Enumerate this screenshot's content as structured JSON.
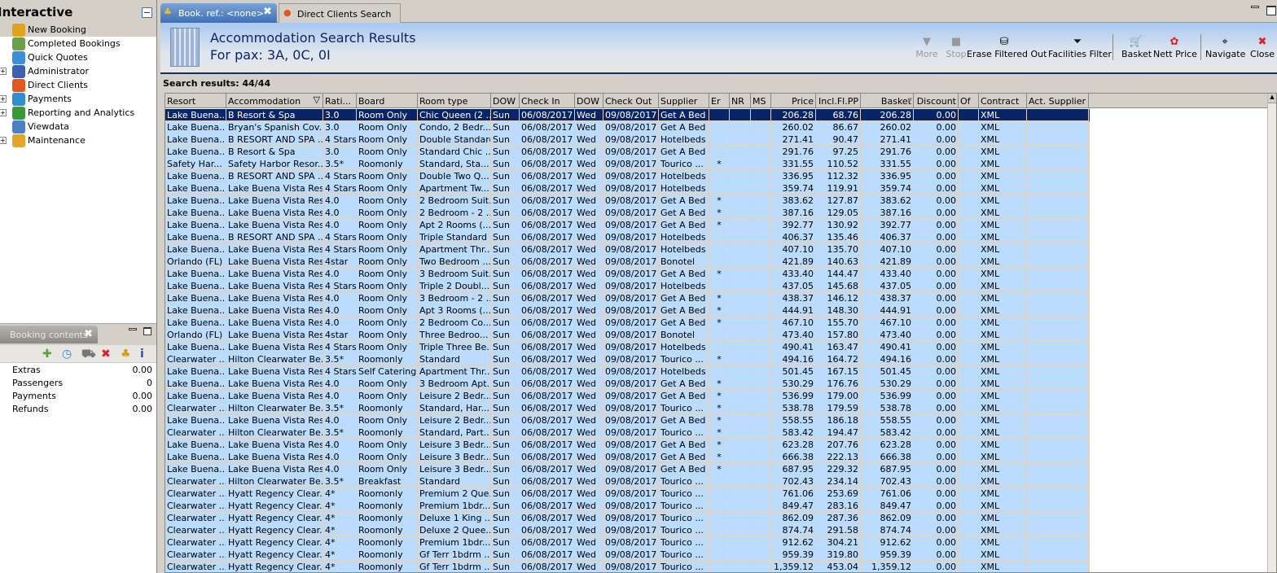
{
  "left": {
    "title": "Interactive",
    "items": [
      {
        "label": "New Booking",
        "icon": "palm-tree-icon",
        "color": "#e3a21a",
        "expandable": false,
        "selected": true
      },
      {
        "label": "Completed Bookings",
        "icon": "palm-money-icon",
        "color": "#6aa04a",
        "expandable": false
      },
      {
        "label": "Quick Quotes",
        "icon": "clock-icon",
        "color": "#3d8fd9",
        "expandable": false
      },
      {
        "label": "Administrator",
        "icon": "runner-icon",
        "color": "#3a62b0",
        "expandable": true
      },
      {
        "label": "Direct Clients",
        "icon": "client-icon",
        "color": "#e2581f",
        "expandable": false
      },
      {
        "label": "Payments",
        "icon": "payment-card-icon",
        "color": "#2f8fd0",
        "expandable": true
      },
      {
        "label": "Reporting and Analytics",
        "icon": "report-icon",
        "color": "#3a9a3a",
        "expandable": true
      },
      {
        "label": "Viewdata",
        "icon": "globe-icon",
        "color": "#4b7fc9",
        "expandable": false
      },
      {
        "label": "Maintenance",
        "icon": "maintenance-icon",
        "color": "#e2a52a",
        "expandable": true
      }
    ]
  },
  "booking_contents": {
    "tab": "Booking contents",
    "tools": [
      {
        "icon": "add-icon",
        "glyph": "✚",
        "color": "#5aa33a"
      },
      {
        "icon": "clock-icon",
        "glyph": "◷",
        "color": "#2b86d6"
      },
      {
        "icon": "cart-icon",
        "glyph": "⛟",
        "color": "#777"
      },
      {
        "icon": "delete-icon",
        "glyph": "✖",
        "color": "#e02020"
      },
      {
        "icon": "palm-tree-icon",
        "glyph": "♣",
        "color": "#d79b12"
      },
      {
        "icon": "info-icon",
        "glyph": "i",
        "color": "#1e55b0"
      }
    ],
    "rows": [
      {
        "label": "Extras",
        "value": "0.00"
      },
      {
        "label": "Passengers",
        "value": "0"
      },
      {
        "label": "Payments",
        "value": "0.00"
      },
      {
        "label": "Refunds",
        "value": "0.00"
      }
    ]
  },
  "tabs": [
    {
      "label": "Book. ref.: <none>"
    },
    {
      "label": "Direct Clients Search"
    }
  ],
  "header": {
    "title": "Accommodation Search Results",
    "pax": "For pax: 3A, 0C, 0I"
  },
  "toolbar": [
    {
      "label": "More",
      "glyph": "▼",
      "disabled": true
    },
    {
      "label": "Stop",
      "glyph": "■",
      "disabled": true
    },
    {
      "label": "Erase Filtered Out",
      "glyph": "⛁",
      "disabled": false
    },
    {
      "label": "Facilities Filter",
      "glyph": "⏷",
      "disabled": false
    },
    {
      "label": "Basket",
      "glyph": "🛒",
      "disabled": false
    },
    {
      "label": "Nett Price",
      "glyph": "✿",
      "disabled": false
    },
    {
      "label": "Navigate",
      "glyph": "⌖",
      "disabled": false
    },
    {
      "label": "Close",
      "glyph": "✖",
      "disabled": false
    }
  ],
  "search_results": "Search results: 44/44",
  "table": {
    "columns": [
      "Resort",
      "Accommodation",
      "Rati...",
      "Board",
      "Room type",
      "DOW",
      "Check In",
      "DOW",
      "Check Out",
      "Supplier",
      "Er",
      "NR",
      "MS",
      "Price",
      "Incl.Fl.PP",
      "Basket",
      "Discount",
      "Of",
      "Contract",
      "Act. Supplier"
    ],
    "filter_column": "Accommodation",
    "sort_column": "Basket",
    "rows": [
      [
        "Lake Buena...",
        "B Resort & Spa",
        "3.0",
        "Room Only",
        "Chic Queen (2 ...",
        "Sun",
        "06/08/2017",
        "Wed",
        "09/08/2017",
        "Get A Bed",
        "",
        "",
        "",
        "206.28",
        "68.76",
        "206.28",
        "0.00",
        "",
        "XML",
        ""
      ],
      [
        "Lake Buena...",
        "Bryan's Spanish Cov...",
        "3.0",
        "Room Only",
        "Condo, 2 Bedr...",
        "Sun",
        "06/08/2017",
        "Wed",
        "09/08/2017",
        "Get A Bed",
        "",
        "",
        "",
        "260.02",
        "86.67",
        "260.02",
        "0.00",
        "",
        "XML",
        ""
      ],
      [
        "Lake Buena...",
        "B RESORT AND SPA ...",
        "4 Stars",
        "Room Only",
        "Double Standard",
        "Sun",
        "06/08/2017",
        "Wed",
        "09/08/2017",
        "Hotelbeds",
        "",
        "",
        "",
        "271.41",
        "90.47",
        "271.41",
        "0.00",
        "",
        "XML",
        ""
      ],
      [
        "Lake Buena...",
        "B Resort & Spa",
        "3.0",
        "Room Only",
        "Standard Chic ...",
        "Sun",
        "06/08/2017",
        "Wed",
        "09/08/2017",
        "Get A Bed",
        "",
        "",
        "",
        "291.76",
        "97.25",
        "291.76",
        "0.00",
        "",
        "XML",
        ""
      ],
      [
        "Safety Har...",
        "Safety Harbor Resor...",
        "3.5*",
        "Roomonly",
        "Standard, Sta...",
        "Sun",
        "06/08/2017",
        "Wed",
        "09/08/2017",
        "Tourico ...",
        "*",
        "",
        "",
        "331.55",
        "110.52",
        "331.55",
        "0.00",
        "",
        "XML",
        ""
      ],
      [
        "Lake Buena...",
        "B RESORT AND SPA ...",
        "4 Stars",
        "Room Only",
        "Double Two Q...",
        "Sun",
        "06/08/2017",
        "Wed",
        "09/08/2017",
        "Hotelbeds",
        "",
        "",
        "",
        "336.95",
        "112.32",
        "336.95",
        "0.00",
        "",
        "XML",
        ""
      ],
      [
        "Lake Buena...",
        "Lake Buena Vista Res...",
        "4 Stars",
        "Room Only",
        "Apartment Tw...",
        "Sun",
        "06/08/2017",
        "Wed",
        "09/08/2017",
        "Hotelbeds",
        "",
        "",
        "",
        "359.74",
        "119.91",
        "359.74",
        "0.00",
        "",
        "XML",
        ""
      ],
      [
        "Lake Buena...",
        "Lake Buena Vista Res...",
        "4.0",
        "Room Only",
        "2 Bedroom Suit...",
        "Sun",
        "06/08/2017",
        "Wed",
        "09/08/2017",
        "Get A Bed",
        "*",
        "",
        "",
        "383.62",
        "127.87",
        "383.62",
        "0.00",
        "",
        "XML",
        ""
      ],
      [
        "Lake Buena...",
        "Lake Buena Vista Res...",
        "4.0",
        "Room Only",
        "2 Bedroom - 2 ...",
        "Sun",
        "06/08/2017",
        "Wed",
        "09/08/2017",
        "Get A Bed",
        "*",
        "",
        "",
        "387.16",
        "129.05",
        "387.16",
        "0.00",
        "",
        "XML",
        ""
      ],
      [
        "Lake Buena...",
        "Lake Buena Vista Res...",
        "4.0",
        "Room Only",
        "Apt 2 Rooms (...",
        "Sun",
        "06/08/2017",
        "Wed",
        "09/08/2017",
        "Get A Bed",
        "*",
        "",
        "",
        "392.77",
        "130.92",
        "392.77",
        "0.00",
        "",
        "XML",
        ""
      ],
      [
        "Lake Buena...",
        "B RESORT AND SPA ...",
        "4 Stars",
        "Room Only",
        "Triple Standard",
        "Sun",
        "06/08/2017",
        "Wed",
        "09/08/2017",
        "Hotelbeds",
        "",
        "",
        "",
        "406.37",
        "135.46",
        "406.37",
        "0.00",
        "",
        "XML",
        ""
      ],
      [
        "Lake Buena...",
        "Lake Buena Vista Res...",
        "4 Stars",
        "Room Only",
        "Apartment Thr...",
        "Sun",
        "06/08/2017",
        "Wed",
        "09/08/2017",
        "Hotelbeds",
        "",
        "",
        "",
        "407.10",
        "135.70",
        "407.10",
        "0.00",
        "",
        "XML",
        ""
      ],
      [
        "Orlando (FL)",
        "Lake Buena Vista Res...",
        "4star",
        "Room Only",
        "Two Bedroom ...",
        "Sun",
        "06/08/2017",
        "Wed",
        "09/08/2017",
        "Bonotel",
        "",
        "",
        "",
        "421.89",
        "140.63",
        "421.89",
        "0.00",
        "",
        "XML",
        ""
      ],
      [
        "Lake Buena...",
        "Lake Buena Vista Res...",
        "4.0",
        "Room Only",
        "3 Bedroom Suit...",
        "Sun",
        "06/08/2017",
        "Wed",
        "09/08/2017",
        "Get A Bed",
        "*",
        "",
        "",
        "433.40",
        "144.47",
        "433.40",
        "0.00",
        "",
        "XML",
        ""
      ],
      [
        "Lake Buena...",
        "Lake Buena Vista Res...",
        "4 Stars",
        "Room Only",
        "Triple 2  Doubl...",
        "Sun",
        "06/08/2017",
        "Wed",
        "09/08/2017",
        "Hotelbeds",
        "",
        "",
        "",
        "437.05",
        "145.68",
        "437.05",
        "0.00",
        "",
        "XML",
        ""
      ],
      [
        "Lake Buena...",
        "Lake Buena Vista Res...",
        "4.0",
        "Room Only",
        "3 Bedroom - 2 ...",
        "Sun",
        "06/08/2017",
        "Wed",
        "09/08/2017",
        "Get A Bed",
        "*",
        "",
        "",
        "438.37",
        "146.12",
        "438.37",
        "0.00",
        "",
        "XML",
        ""
      ],
      [
        "Lake Buena...",
        "Lake Buena Vista Res...",
        "4.0",
        "Room Only",
        "Apt 3 Rooms (...",
        "Sun",
        "06/08/2017",
        "Wed",
        "09/08/2017",
        "Get A Bed",
        "*",
        "",
        "",
        "444.91",
        "148.30",
        "444.91",
        "0.00",
        "",
        "XML",
        ""
      ],
      [
        "Lake Buena...",
        "Lake Buena Vista Res...",
        "4.0",
        "Room Only",
        "2 Bedroom Co...",
        "Sun",
        "06/08/2017",
        "Wed",
        "09/08/2017",
        "Get A Bed",
        "*",
        "",
        "",
        "467.10",
        "155.70",
        "467.10",
        "0.00",
        "",
        "XML",
        ""
      ],
      [
        "Orlando (FL)",
        "Lake Buena Vista Res...",
        "4star",
        "Room Only",
        "Three Bedroo...",
        "Sun",
        "06/08/2017",
        "Wed",
        "09/08/2017",
        "Bonotel",
        "",
        "",
        "",
        "473.40",
        "157.80",
        "473.40",
        "0.00",
        "",
        "XML",
        ""
      ],
      [
        "Lake Buena...",
        "Lake Buena Vista Res...",
        "4 Stars",
        "Room Only",
        "Triple Three Be...",
        "Sun",
        "06/08/2017",
        "Wed",
        "09/08/2017",
        "Hotelbeds",
        "",
        "",
        "",
        "490.41",
        "163.47",
        "490.41",
        "0.00",
        "",
        "XML",
        ""
      ],
      [
        "Clearwater ...",
        "Hilton Clearwater Be...",
        "3.5*",
        "Roomonly",
        "Standard",
        "Sun",
        "06/08/2017",
        "Wed",
        "09/08/2017",
        "Tourico ...",
        "*",
        "",
        "",
        "494.16",
        "164.72",
        "494.16",
        "0.00",
        "",
        "XML",
        ""
      ],
      [
        "Lake Buena...",
        "Lake Buena Vista Res...",
        "4 Stars",
        "Self Catering",
        "Apartment Thr...",
        "Sun",
        "06/08/2017",
        "Wed",
        "09/08/2017",
        "Hotelbeds",
        "",
        "",
        "",
        "501.45",
        "167.15",
        "501.45",
        "0.00",
        "",
        "XML",
        ""
      ],
      [
        "Lake Buena...",
        "Lake Buena Vista Res...",
        "4.0",
        "Room Only",
        "3 Bedroom Apt...",
        "Sun",
        "06/08/2017",
        "Wed",
        "09/08/2017",
        "Get A Bed",
        "*",
        "",
        "",
        "530.29",
        "176.76",
        "530.29",
        "0.00",
        "",
        "XML",
        ""
      ],
      [
        "Lake Buena...",
        "Lake Buena Vista Res...",
        "4.0",
        "Room Only",
        "Leisure 2 Bedr...",
        "Sun",
        "06/08/2017",
        "Wed",
        "09/08/2017",
        "Get A Bed",
        "*",
        "",
        "",
        "536.99",
        "179.00",
        "536.99",
        "0.00",
        "",
        "XML",
        ""
      ],
      [
        "Clearwater ...",
        "Hilton Clearwater Be...",
        "3.5*",
        "Roomonly",
        "Standard, Har...",
        "Sun",
        "06/08/2017",
        "Wed",
        "09/08/2017",
        "Tourico ...",
        "*",
        "",
        "",
        "538.78",
        "179.59",
        "538.78",
        "0.00",
        "",
        "XML",
        ""
      ],
      [
        "Lake Buena...",
        "Lake Buena Vista Res...",
        "4.0",
        "Room Only",
        "Leisure 2 Bedr...",
        "Sun",
        "06/08/2017",
        "Wed",
        "09/08/2017",
        "Get A Bed",
        "*",
        "",
        "",
        "558.55",
        "186.18",
        "558.55",
        "0.00",
        "",
        "XML",
        ""
      ],
      [
        "Clearwater ...",
        "Hilton Clearwater Be...",
        "3.5*",
        "Roomonly",
        "Standard, Part...",
        "Sun",
        "06/08/2017",
        "Wed",
        "09/08/2017",
        "Tourico ...",
        "*",
        "",
        "",
        "583.42",
        "194.47",
        "583.42",
        "0.00",
        "",
        "XML",
        ""
      ],
      [
        "Lake Buena...",
        "Lake Buena Vista Res...",
        "4.0",
        "Room Only",
        "Leisure 3 Bedr...",
        "Sun",
        "06/08/2017",
        "Wed",
        "09/08/2017",
        "Get A Bed",
        "*",
        "",
        "",
        "623.28",
        "207.76",
        "623.28",
        "0.00",
        "",
        "XML",
        ""
      ],
      [
        "Lake Buena...",
        "Lake Buena Vista Res...",
        "4.0",
        "Room Only",
        "Leisure 3 Bedr...",
        "Sun",
        "06/08/2017",
        "Wed",
        "09/08/2017",
        "Get A Bed",
        "*",
        "",
        "",
        "666.38",
        "222.13",
        "666.38",
        "0.00",
        "",
        "XML",
        ""
      ],
      [
        "Lake Buena...",
        "Lake Buena Vista Res...",
        "4.0",
        "Room Only",
        "Leisure 3 Bedr...",
        "Sun",
        "06/08/2017",
        "Wed",
        "09/08/2017",
        "Get A Bed",
        "*",
        "",
        "",
        "687.95",
        "229.32",
        "687.95",
        "0.00",
        "",
        "XML",
        ""
      ],
      [
        "Clearwater ...",
        "Hilton Clearwater Be...",
        "3.5*",
        "Breakfast",
        "Standard",
        "Sun",
        "06/08/2017",
        "Wed",
        "09/08/2017",
        "Tourico ...",
        "",
        "",
        "",
        "702.43",
        "234.14",
        "702.43",
        "0.00",
        "",
        "XML",
        ""
      ],
      [
        "Clearwater ...",
        "Hyatt Regency Clear...",
        "4*",
        "Roomonly",
        "Premium 2 Que...",
        "Sun",
        "06/08/2017",
        "Wed",
        "09/08/2017",
        "Tourico ...",
        "",
        "",
        "",
        "761.06",
        "253.69",
        "761.06",
        "0.00",
        "",
        "XML",
        ""
      ],
      [
        "Clearwater ...",
        "Hyatt Regency Clear...",
        "4*",
        "Roomonly",
        "Premium 1bdr...",
        "Sun",
        "06/08/2017",
        "Wed",
        "09/08/2017",
        "Tourico ...",
        "",
        "",
        "",
        "849.47",
        "283.16",
        "849.47",
        "0.00",
        "",
        "XML",
        ""
      ],
      [
        "Clearwater ...",
        "Hyatt Regency Clear...",
        "4*",
        "Roomonly",
        "Deluxe 1 King ...",
        "Sun",
        "06/08/2017",
        "Wed",
        "09/08/2017",
        "Tourico ...",
        "",
        "",
        "",
        "862.09",
        "287.36",
        "862.09",
        "0.00",
        "",
        "XML",
        ""
      ],
      [
        "Clearwater ...",
        "Hyatt Regency Clear...",
        "4*",
        "Roomonly",
        "Deluxe 2 Quee...",
        "Sun",
        "06/08/2017",
        "Wed",
        "09/08/2017",
        "Tourico ...",
        "",
        "",
        "",
        "874.74",
        "291.58",
        "874.74",
        "0.00",
        "",
        "XML",
        ""
      ],
      [
        "Clearwater ...",
        "Hyatt Regency Clear...",
        "4*",
        "Roomonly",
        "Premium 1bdr...",
        "Sun",
        "06/08/2017",
        "Wed",
        "09/08/2017",
        "Tourico ...",
        "",
        "",
        "",
        "912.62",
        "304.21",
        "912.62",
        "0.00",
        "",
        "XML",
        ""
      ],
      [
        "Clearwater ...",
        "Hyatt Regency Clear...",
        "4*",
        "Roomonly",
        "Gf Terr 1bdrm ...",
        "Sun",
        "06/08/2017",
        "Wed",
        "09/08/2017",
        "Tourico ...",
        "",
        "",
        "",
        "959.39",
        "319.80",
        "959.39",
        "0.00",
        "",
        "XML",
        ""
      ],
      [
        "Clearwater ...",
        "Hyatt Regency Clear...",
        "4*",
        "Roomonly",
        "Gf Terr 1bdrm ...",
        "Sun",
        "06/08/2017",
        "Wed",
        "09/08/2017",
        "Tourico ...",
        "",
        "",
        "",
        "1,359.12",
        "453.04",
        "1,359.12",
        "0.00",
        "",
        "XML",
        ""
      ]
    ]
  }
}
